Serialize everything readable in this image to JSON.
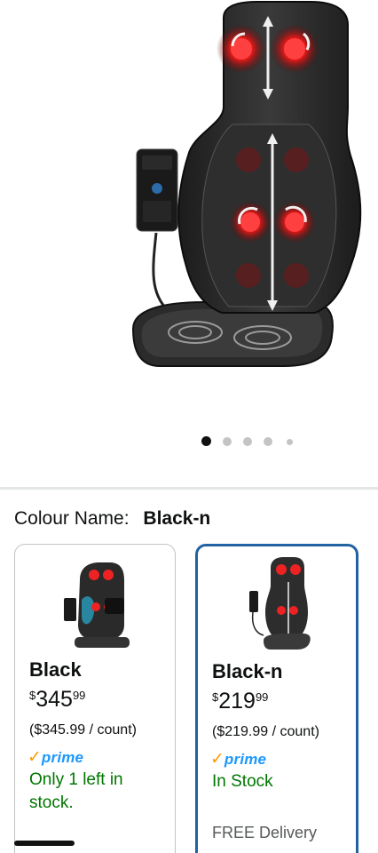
{
  "gallery": {
    "image_count": 5,
    "active_index": 0
  },
  "variation": {
    "label": "Colour Name:",
    "selected_value": "Black-n"
  },
  "options": [
    {
      "name": "Black",
      "price_symbol": "$",
      "price_whole": "345",
      "price_fraction": "99",
      "unit_price": "($345.99 / count)",
      "prime_check": "✓",
      "prime_word": "prime",
      "availability": "Only 1 left in stock.",
      "selected": false
    },
    {
      "name": "Black-n",
      "price_symbol": "$",
      "price_whole": "219",
      "price_fraction": "99",
      "unit_price": "($219.99 / count)",
      "prime_check": "✓",
      "prime_word": "prime",
      "availability": "In Stock",
      "delivery": "FREE Delivery",
      "selected": true
    }
  ],
  "colors": {
    "selected_border": "#2162a1",
    "in_stock": "#007600",
    "prime_blue": "#1a98ff",
    "prime_check": "#ff9900"
  }
}
